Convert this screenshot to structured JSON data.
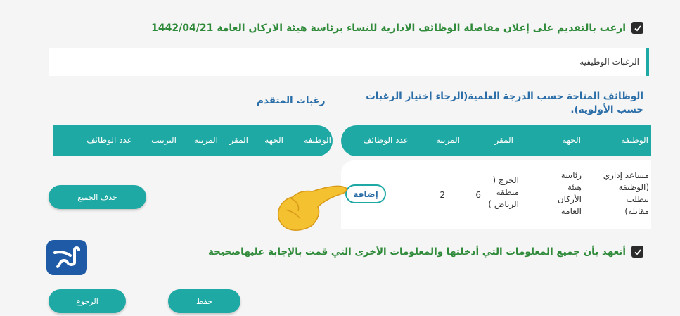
{
  "top_checkbox": {
    "label": "ارغب بالتقديم على إعلان مفاضلة الوظائف الادارية للنساء برئاسة هيئة الاركان العامة 1442/04/21"
  },
  "section": {
    "title": "الرغبات الوظيفية"
  },
  "available": {
    "title": "الوظائف المتاحة حسب الدرجة العلمية(الرجاء إختيار الرغبات حسب الأولوية).",
    "headers": [
      "الوظيفة",
      "الجهة",
      "المقر",
      "المرتبة",
      "عدد الوظائف"
    ],
    "row": {
      "job": [
        "مساعد إداري",
        "(الوظيفة",
        "تتطلب",
        "مقابلة)"
      ],
      "entity": [
        "رئاسة",
        "هيئة",
        "الأركان",
        "العامة"
      ],
      "location": [
        "الخرج (",
        "منطقة",
        "الرياض )"
      ],
      "rank": "6",
      "count": "2",
      "add_label": "إضافة"
    }
  },
  "chosen": {
    "title": "رغبات المتقدم",
    "headers": [
      "الوظيفة",
      "الجهة",
      "المقر",
      "المرتبة",
      "الترتيب",
      "عدد الوظائف"
    ],
    "delete_all_label": "حذف الجميع"
  },
  "pledge": {
    "label": "أتعهد بأن جميع المعلومات التي أدخلتها والمعلومات الأخرى التي قمت بالإجابة عليهاصحيحة"
  },
  "actions": {
    "save_label": "حفظ",
    "back_label": "الرجوع"
  },
  "colors": {
    "teal": "#1fa9a4",
    "green_text": "#2f8a3a",
    "blue_text": "#2b6ea8",
    "logo_bg": "#1e5aa6"
  }
}
